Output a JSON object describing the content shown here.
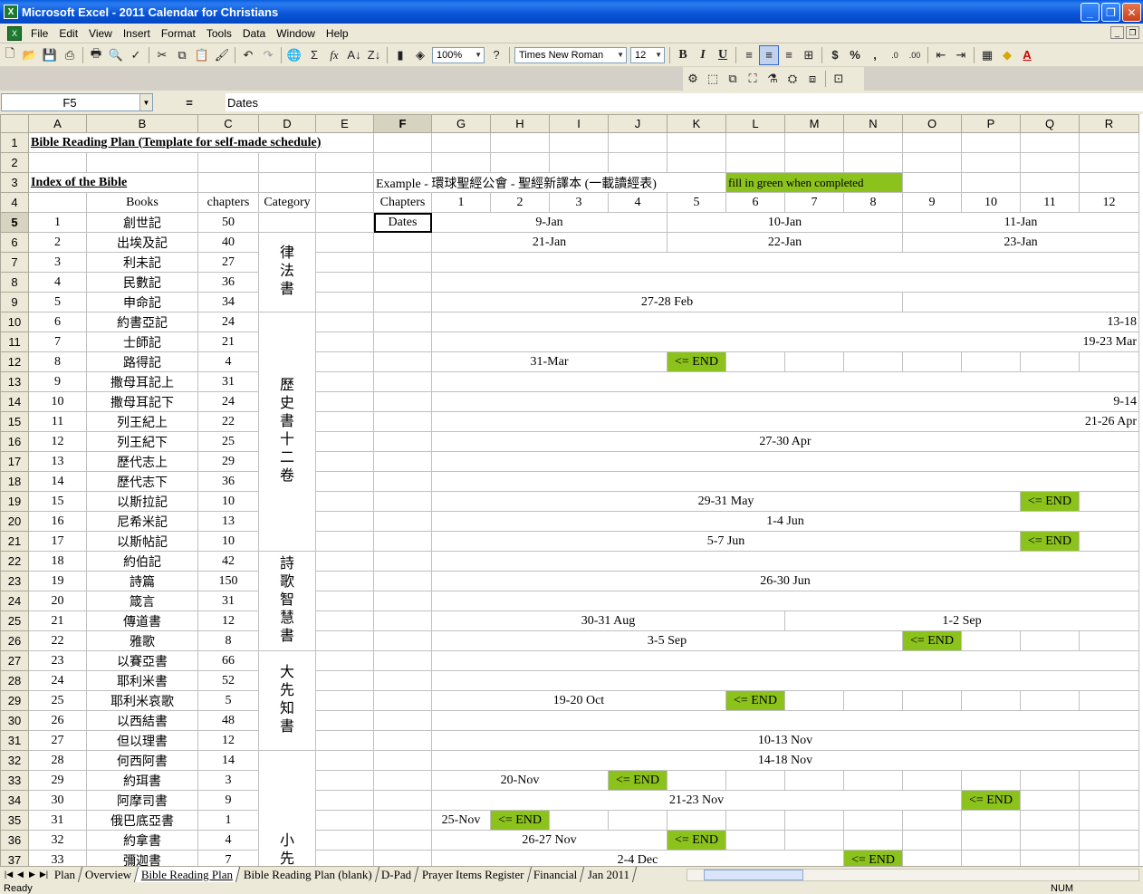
{
  "window": {
    "title": "Microsoft Excel - 2011 Calendar for Christians"
  },
  "menu": [
    "File",
    "Edit",
    "View",
    "Insert",
    "Format",
    "Tools",
    "Data",
    "Window",
    "Help"
  ],
  "toolbar": {
    "zoom": "100%",
    "font": "Times New Roman",
    "size": "12"
  },
  "formula_bar": {
    "cell": "F5",
    "eq": "=",
    "value": "Dates"
  },
  "columns": [
    "A",
    "B",
    "C",
    "D",
    "E",
    "F",
    "G",
    "H",
    "I",
    "J",
    "K",
    "L",
    "M",
    "N",
    "O",
    "P",
    "Q",
    "R"
  ],
  "rows_header": [
    "1",
    "2",
    "3",
    "4",
    "5",
    "6",
    "7",
    "8",
    "9",
    "10",
    "11",
    "12",
    "13",
    "14",
    "15",
    "16",
    "17",
    "18",
    "19",
    "20",
    "21",
    "22",
    "23",
    "24",
    "25",
    "26",
    "27",
    "28",
    "29",
    "30",
    "31",
    "32",
    "33",
    "34",
    "35",
    "36",
    "37"
  ],
  "sheet": {
    "title": "Bible Reading Plan (Template for self-made schedule)",
    "index_title": "Index of the Bible",
    "example_text": "Example - 環球聖經公會 - 聖經新譯本 (一載讀經表)",
    "green_note": "fill in green when completed",
    "hdr_books": "Books",
    "hdr_chapters": "chapters",
    "hdr_category": "Category",
    "hdr_chapters_f": "Chapters",
    "chapter_nums": [
      "1",
      "2",
      "3",
      "4",
      "5",
      "6",
      "7",
      "8",
      "9",
      "10",
      "11",
      "12"
    ],
    "dates_label": "Dates",
    "books": [
      [
        "1",
        "創世記",
        "50"
      ],
      [
        "2",
        "出埃及記",
        "40"
      ],
      [
        "3",
        "利未記",
        "27"
      ],
      [
        "4",
        "民數記",
        "36"
      ],
      [
        "5",
        "申命記",
        "34"
      ],
      [
        "6",
        "約書亞記",
        "24"
      ],
      [
        "7",
        "士師記",
        "21"
      ],
      [
        "8",
        "路得記",
        "4"
      ],
      [
        "9",
        "撒母耳記上",
        "31"
      ],
      [
        "10",
        "撒母耳記下",
        "24"
      ],
      [
        "11",
        "列王紀上",
        "22"
      ],
      [
        "12",
        "列王紀下",
        "25"
      ],
      [
        "13",
        "歷代志上",
        "29"
      ],
      [
        "14",
        "歷代志下",
        "36"
      ],
      [
        "15",
        "以斯拉記",
        "10"
      ],
      [
        "16",
        "尼希米記",
        "13"
      ],
      [
        "17",
        "以斯帖記",
        "10"
      ],
      [
        "18",
        "約伯記",
        "42"
      ],
      [
        "19",
        "詩篇",
        "150"
      ],
      [
        "20",
        "箴言",
        "31"
      ],
      [
        "21",
        "傳道書",
        "12"
      ],
      [
        "22",
        "雅歌",
        "8"
      ],
      [
        "23",
        "以賽亞書",
        "66"
      ],
      [
        "24",
        "耶利米書",
        "52"
      ],
      [
        "25",
        "耶利米哀歌",
        "5"
      ],
      [
        "26",
        "以西結書",
        "48"
      ],
      [
        "27",
        "但以理書",
        "12"
      ],
      [
        "28",
        "何西阿書",
        "14"
      ],
      [
        "29",
        "約珥書",
        "3"
      ],
      [
        "30",
        "阿摩司書",
        "9"
      ],
      [
        "31",
        "俄巴底亞書",
        "1"
      ],
      [
        "32",
        "約拿書",
        "4"
      ],
      [
        "33",
        "彌迦書",
        "7"
      ]
    ],
    "categories": {
      "law": "律法書",
      "history": "歷史書十二卷",
      "poetry": "詩歌智慧書",
      "major": "大先知書",
      "minor": "小先"
    },
    "end_label": "<= END",
    "dates": {
      "r5a": "9-Jan",
      "r5b": "10-Jan",
      "r5c": "11-Jan",
      "r6a": "21-Jan",
      "r6b": "22-Jan",
      "r6c": "23-Jan",
      "r9": "27-28 Feb",
      "r10": "13-18",
      "r11": "19-23 Mar",
      "r12": "31-Mar",
      "r14": "9-14",
      "r15": "21-26 Apr",
      "r16": "27-30 Apr",
      "r19": "29-31 May",
      "r20": "1-4 Jun",
      "r21": "5-7 Jun",
      "r23": "26-30 Jun",
      "r25a": "30-31 Aug",
      "r25b": "1-2 Sep",
      "r26": "3-5 Sep",
      "r29": "19-20 Oct",
      "r31": "10-13 Nov",
      "r32": "14-18 Nov",
      "r33": "20-Nov",
      "r34": "21-23 Nov",
      "r35": "25-Nov",
      "r36": "26-27 Nov",
      "r37": "2-4 Dec"
    }
  },
  "tabs": [
    "Plan",
    "Overview",
    "Bible Reading Plan",
    "Bible Reading Plan (blank)",
    "D-Pad",
    "Prayer Items Register",
    "Financial",
    "Jan 2011"
  ],
  "status": {
    "ready": "Ready",
    "num": "NUM"
  },
  "colors": {
    "green": "#8cc21c",
    "titlebar": "#0a5fe0"
  }
}
